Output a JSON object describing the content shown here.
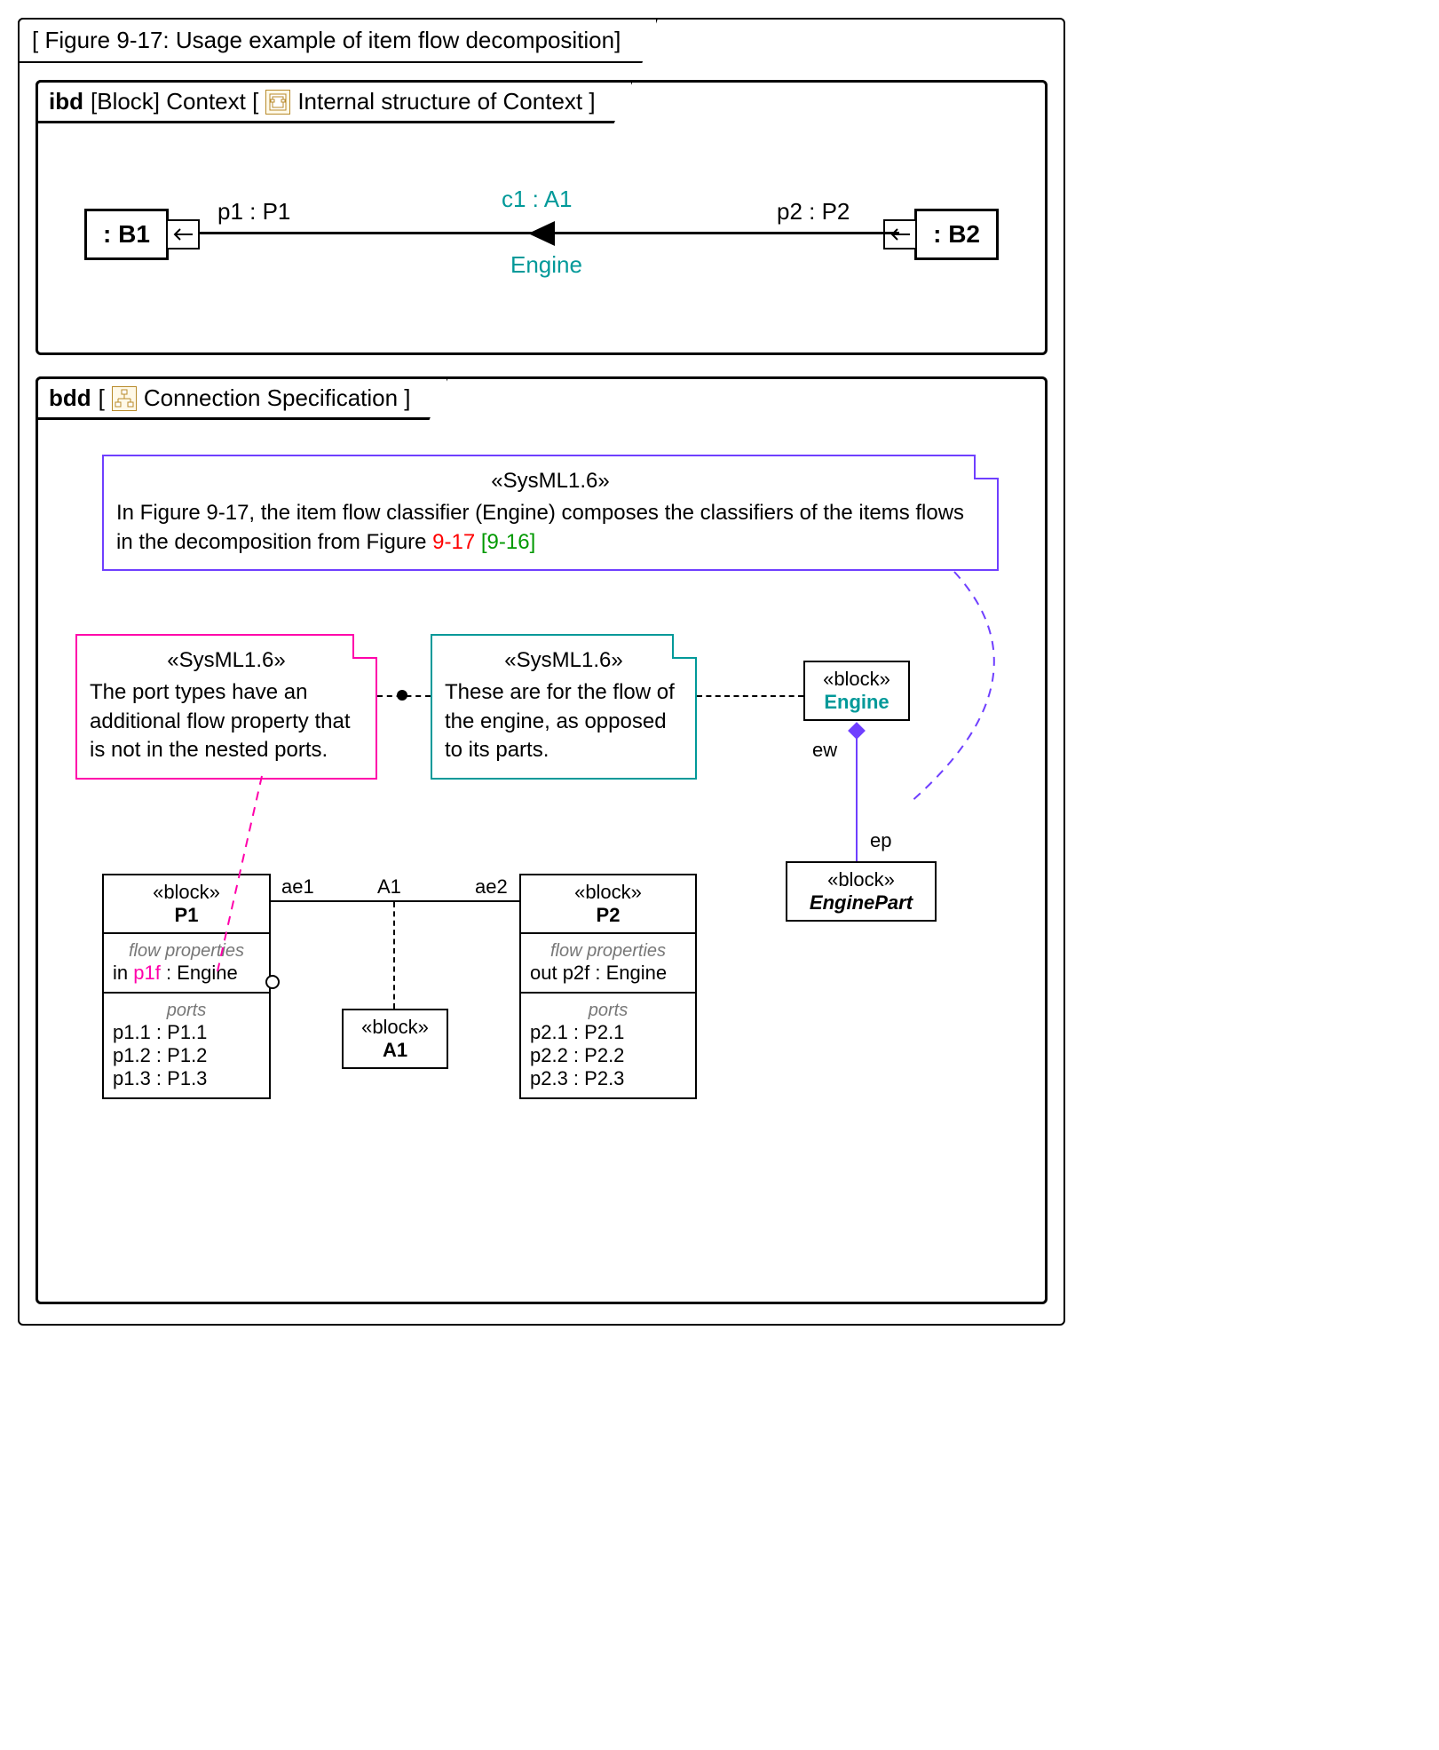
{
  "figure_title": "[ Figure 9-17: Usage example of item flow decomposition]",
  "ibd": {
    "tab_prefix": "ibd",
    "tab_frame": "[Block] Context [",
    "tab_suffix": "Internal structure of Context ]",
    "b1": ": B1",
    "b2": ": B2",
    "p1": "p1 : P1",
    "p2": "p2 : P2",
    "flow_name": "c1 : A1",
    "flow_type": "Engine"
  },
  "bdd": {
    "tab_prefix": "bdd",
    "tab_bracket_open": "[",
    "tab_title": "Connection Specification ]",
    "note_purple": {
      "stereo": "«SysML1.6»",
      "text_a": "In Figure 9-17, the item flow classifier (Engine) composes the classifiers of the items flows in the decomposition from Figure ",
      "text_red": "9-17",
      "text_green": " [9-16]"
    },
    "note_magenta": {
      "stereo": "«SysML1.6»",
      "text": "The port types have an additional flow property that is not in the nested ports."
    },
    "note_teal": {
      "stereo": "«SysML1.6»",
      "text": "These are for the flow of the engine, as opposed to its parts."
    },
    "engine": {
      "stereo": "«block»",
      "name": "Engine",
      "role_ew": "ew",
      "role_ep": "ep"
    },
    "enginepart": {
      "stereo": "«block»",
      "name": "EnginePart"
    },
    "p1": {
      "stereo": "«block»",
      "name": "P1",
      "flow_label": "flow properties",
      "flow": "in p1f : Engine",
      "flow_hl": "p1f",
      "ports_label": "ports",
      "ports": [
        "p1.1 : P1.1",
        "p1.2 : P1.2",
        "p1.3 : P1.3"
      ]
    },
    "p2": {
      "stereo": "«block»",
      "name": "P2",
      "flow_label": "flow properties",
      "flow": "out p2f : Engine",
      "ports_label": "ports",
      "ports": [
        "p2.1 : P2.1",
        "p2.2 : P2.2",
        "p2.3 : P2.3"
      ]
    },
    "a1": {
      "stereo": "«block»",
      "name": "A1",
      "assoc_name": "A1",
      "end1": "ae1",
      "end2": "ae2"
    }
  }
}
